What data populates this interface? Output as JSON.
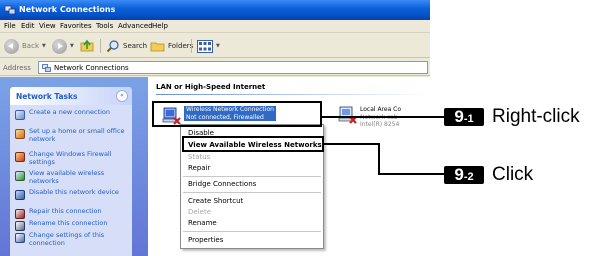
{
  "window": {
    "title": "Network Connections"
  },
  "menubar": {
    "items": [
      "File",
      "Edit",
      "View",
      "Favorites",
      "Tools",
      "Advanced",
      "Help"
    ]
  },
  "toolbar": {
    "back_label": "Back",
    "search_label": "Search",
    "folders_label": "Folders"
  },
  "addressbar": {
    "label": "Address",
    "value": "Network Connections"
  },
  "sidebar": {
    "title": "Network Tasks",
    "collapse_symbol": "«",
    "tasks": [
      {
        "label": "Create a new connection",
        "icon": "new-connection-icon"
      },
      {
        "label": "Set up a home or small office network",
        "icon": "home-network-icon"
      },
      {
        "label": "Change Windows Firewall settings",
        "icon": "firewall-icon"
      },
      {
        "label": "View available wireless networks",
        "icon": "wireless-icon"
      },
      {
        "label": "Disable this network device",
        "icon": "disable-icon"
      },
      {
        "label": "Repair this connection",
        "icon": "repair-icon"
      },
      {
        "label": "Rename this connection",
        "icon": "rename-icon"
      },
      {
        "label": "Change settings of this connection",
        "icon": "settings-icon"
      }
    ]
  },
  "main": {
    "group_title": "LAN or High-Speed Internet",
    "connections": [
      {
        "name": "Wireless Network Connection",
        "status": "Not connected, Firewalled"
      },
      {
        "name": "Local Area Co",
        "status": "Network cab",
        "device": "Intel(R) 8254"
      }
    ]
  },
  "context_menu": {
    "items": [
      {
        "label": "Disable",
        "state": "normal"
      },
      {
        "label": "View Available Wireless Networks",
        "state": "bold"
      },
      {
        "label": "Status",
        "state": "disabled"
      },
      {
        "label": "Repair",
        "state": "normal"
      },
      {
        "label": "Bridge Connections",
        "state": "normal"
      },
      {
        "label": "Create Shortcut",
        "state": "normal"
      },
      {
        "label": "Delete",
        "state": "disabled"
      },
      {
        "label": "Rename",
        "state": "normal"
      },
      {
        "label": "Properties",
        "state": "normal"
      }
    ]
  },
  "annotations": [
    {
      "badge_num": "9",
      "badge_sub": "-1",
      "text": "Right-click"
    },
    {
      "badge_num": "9",
      "badge_sub": "-2",
      "text": "Click"
    }
  ],
  "colors": {
    "titlebar": "#0a5fd8",
    "sidebar_bg": "#6f8ee0",
    "task_link": "#215dc6",
    "selection": "#316ac5"
  }
}
